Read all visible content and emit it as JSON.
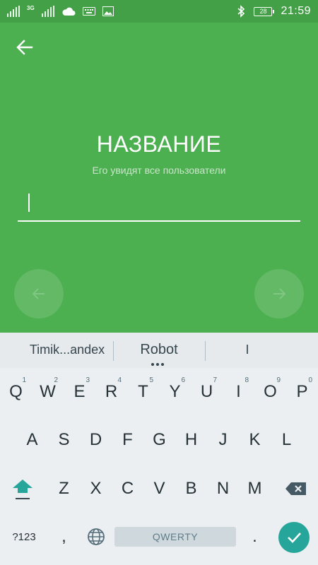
{
  "status_bar": {
    "network_type": "3G",
    "battery_level": "28",
    "time": "21:59",
    "icons": [
      "signal-icon",
      "cloud-icon",
      "keyboard-icon",
      "image-icon",
      "bluetooth-icon",
      "battery-icon"
    ]
  },
  "screen": {
    "title": "НАЗВАНИЕ",
    "subtitle": "Его увидят все пользователи",
    "input_value": "",
    "colors": {
      "background": "#4caf50",
      "status_bar": "#43a047",
      "accent": "#26a69a"
    }
  },
  "keyboard": {
    "suggestions": [
      "Timik...andex",
      "Robot",
      "I"
    ],
    "row1": [
      {
        "label": "Q",
        "hint": "1"
      },
      {
        "label": "W",
        "hint": "2"
      },
      {
        "label": "E",
        "hint": "3"
      },
      {
        "label": "R",
        "hint": "4"
      },
      {
        "label": "T",
        "hint": "5"
      },
      {
        "label": "Y",
        "hint": "6"
      },
      {
        "label": "U",
        "hint": "7"
      },
      {
        "label": "I",
        "hint": "8"
      },
      {
        "label": "O",
        "hint": "9"
      },
      {
        "label": "P",
        "hint": "0"
      }
    ],
    "row2": [
      "A",
      "S",
      "D",
      "F",
      "G",
      "H",
      "J",
      "K",
      "L"
    ],
    "row3": [
      "Z",
      "X",
      "C",
      "V",
      "B",
      "N",
      "M"
    ],
    "symbols_label": "?123",
    "comma_label": ",",
    "space_label": "QWERTY",
    "period_label": "."
  }
}
